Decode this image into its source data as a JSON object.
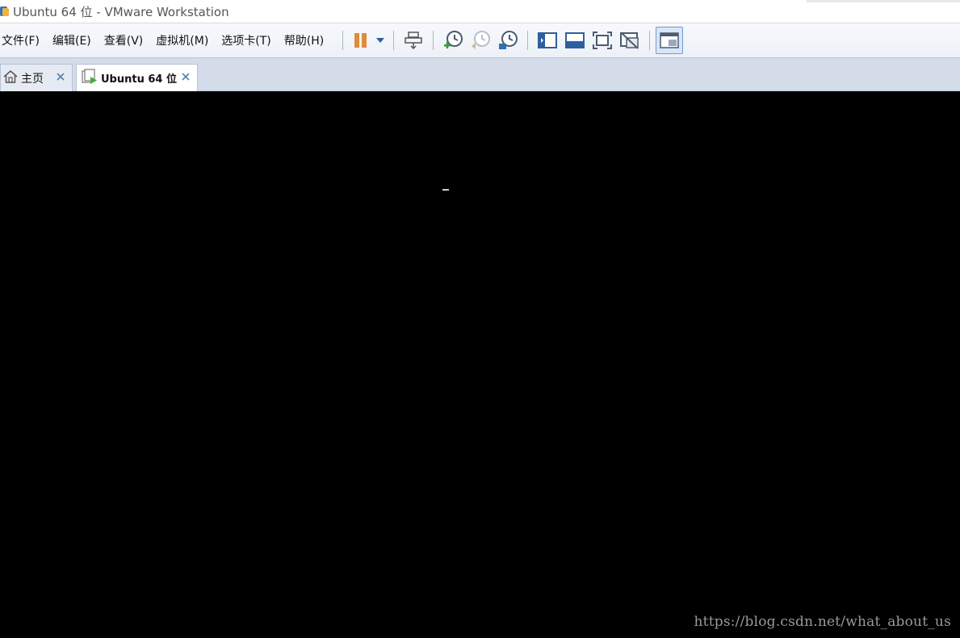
{
  "window": {
    "title": "Ubuntu 64 位 - VMware Workstation",
    "app_icon": "vmware-icon"
  },
  "menu": {
    "items": [
      {
        "label": "文件(F)",
        "name": "menu-file"
      },
      {
        "label": "编辑(E)",
        "name": "menu-edit"
      },
      {
        "label": "查看(V)",
        "name": "menu-view"
      },
      {
        "label": "虚拟机(M)",
        "name": "menu-vm"
      },
      {
        "label": "选项卡(T)",
        "name": "menu-tabs"
      },
      {
        "label": "帮助(H)",
        "name": "menu-help"
      }
    ]
  },
  "toolbar": {
    "buttons": [
      "pause-icon",
      "dropdown-arrow-icon",
      "send-ctrl-alt-del-icon",
      "snapshot-take-icon",
      "snapshot-revert-icon",
      "snapshot-manager-icon",
      "show-library-icon",
      "show-thumbnail-bar-icon",
      "fullscreen-icon",
      "unity-icon",
      "console-view-icon"
    ],
    "colors": {
      "pause": "#e08a3c",
      "accent": "#2f5f9e"
    }
  },
  "tabs": [
    {
      "label": "主页",
      "icon": "home-icon",
      "active": false
    },
    {
      "label": "Ubuntu 64 位",
      "icon": "vm-running-icon",
      "active": true
    }
  ],
  "console": {
    "cursor_char": "_",
    "watermark": "https://blog.csdn.net/what_about_us"
  }
}
